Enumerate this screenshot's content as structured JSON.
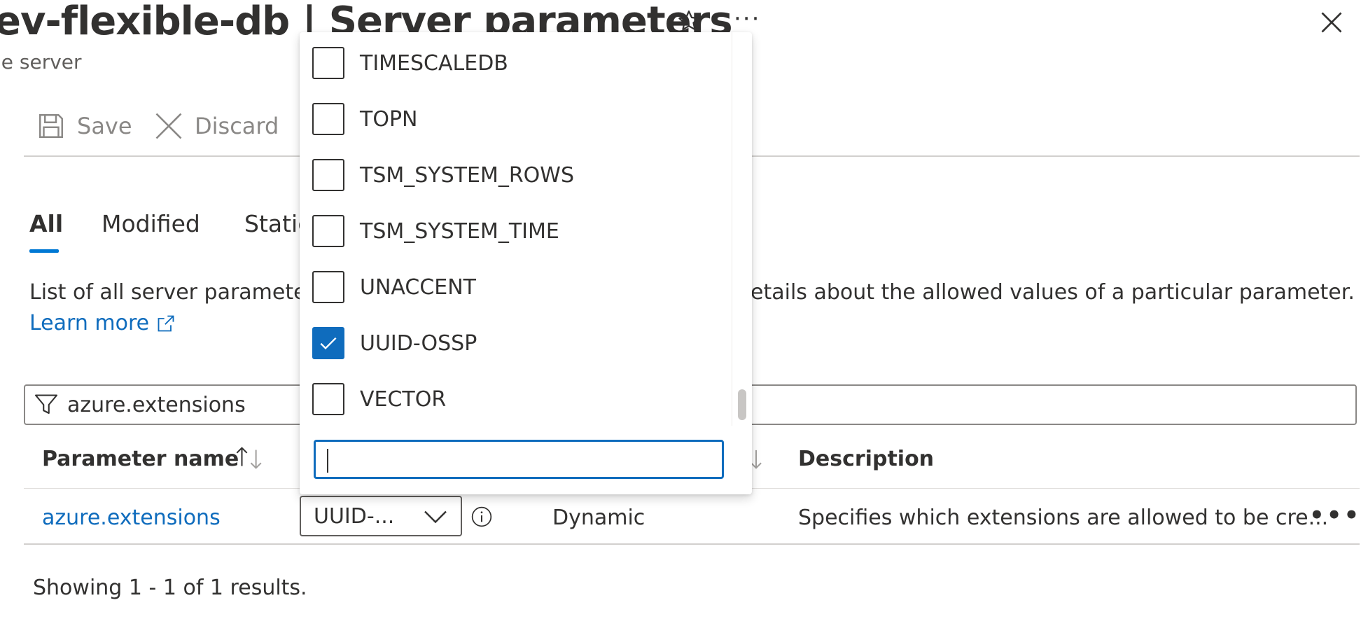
{
  "header": {
    "title": "ev-flexible-db | Server parameters",
    "subtitle": "le server",
    "icons": [
      "star-icon",
      "more-icon",
      "close-icon"
    ],
    "more_label": "···"
  },
  "toolbar": {
    "save_label": "Save",
    "discard_label": "Discard"
  },
  "tabs": [
    {
      "label": "All",
      "selected": true
    },
    {
      "label": "Modified",
      "selected": false
    },
    {
      "label": "Static",
      "selected": false
    }
  ],
  "description": {
    "left": "List of all server parameters",
    "right": "etails about the allowed values of a particular parameter.",
    "learn_more": "Learn more"
  },
  "filter": {
    "value": "azure.extensions"
  },
  "table": {
    "headers": {
      "name": "Parameter name",
      "description": "Description"
    },
    "rows": [
      {
        "name": "azure.extensions",
        "value": "UUID-...",
        "type": "Dynamic",
        "description": "Specifies which extensions are allowed to be cre..."
      }
    ],
    "row_more": "•••"
  },
  "results_text": "Showing 1 - 1 of 1 results.",
  "dropdown": {
    "options": [
      {
        "label": "TIMESCALEDB",
        "checked": false
      },
      {
        "label": "TOPN",
        "checked": false
      },
      {
        "label": "TSM_SYSTEM_ROWS",
        "checked": false
      },
      {
        "label": "TSM_SYSTEM_TIME",
        "checked": false
      },
      {
        "label": "UNACCENT",
        "checked": false
      },
      {
        "label": "UUID-OSSP",
        "checked": true
      },
      {
        "label": "VECTOR",
        "checked": false
      }
    ],
    "search_value": ""
  },
  "colors": {
    "accent": "#0f6cbd",
    "text": "#323130",
    "muted": "#8a8886"
  }
}
